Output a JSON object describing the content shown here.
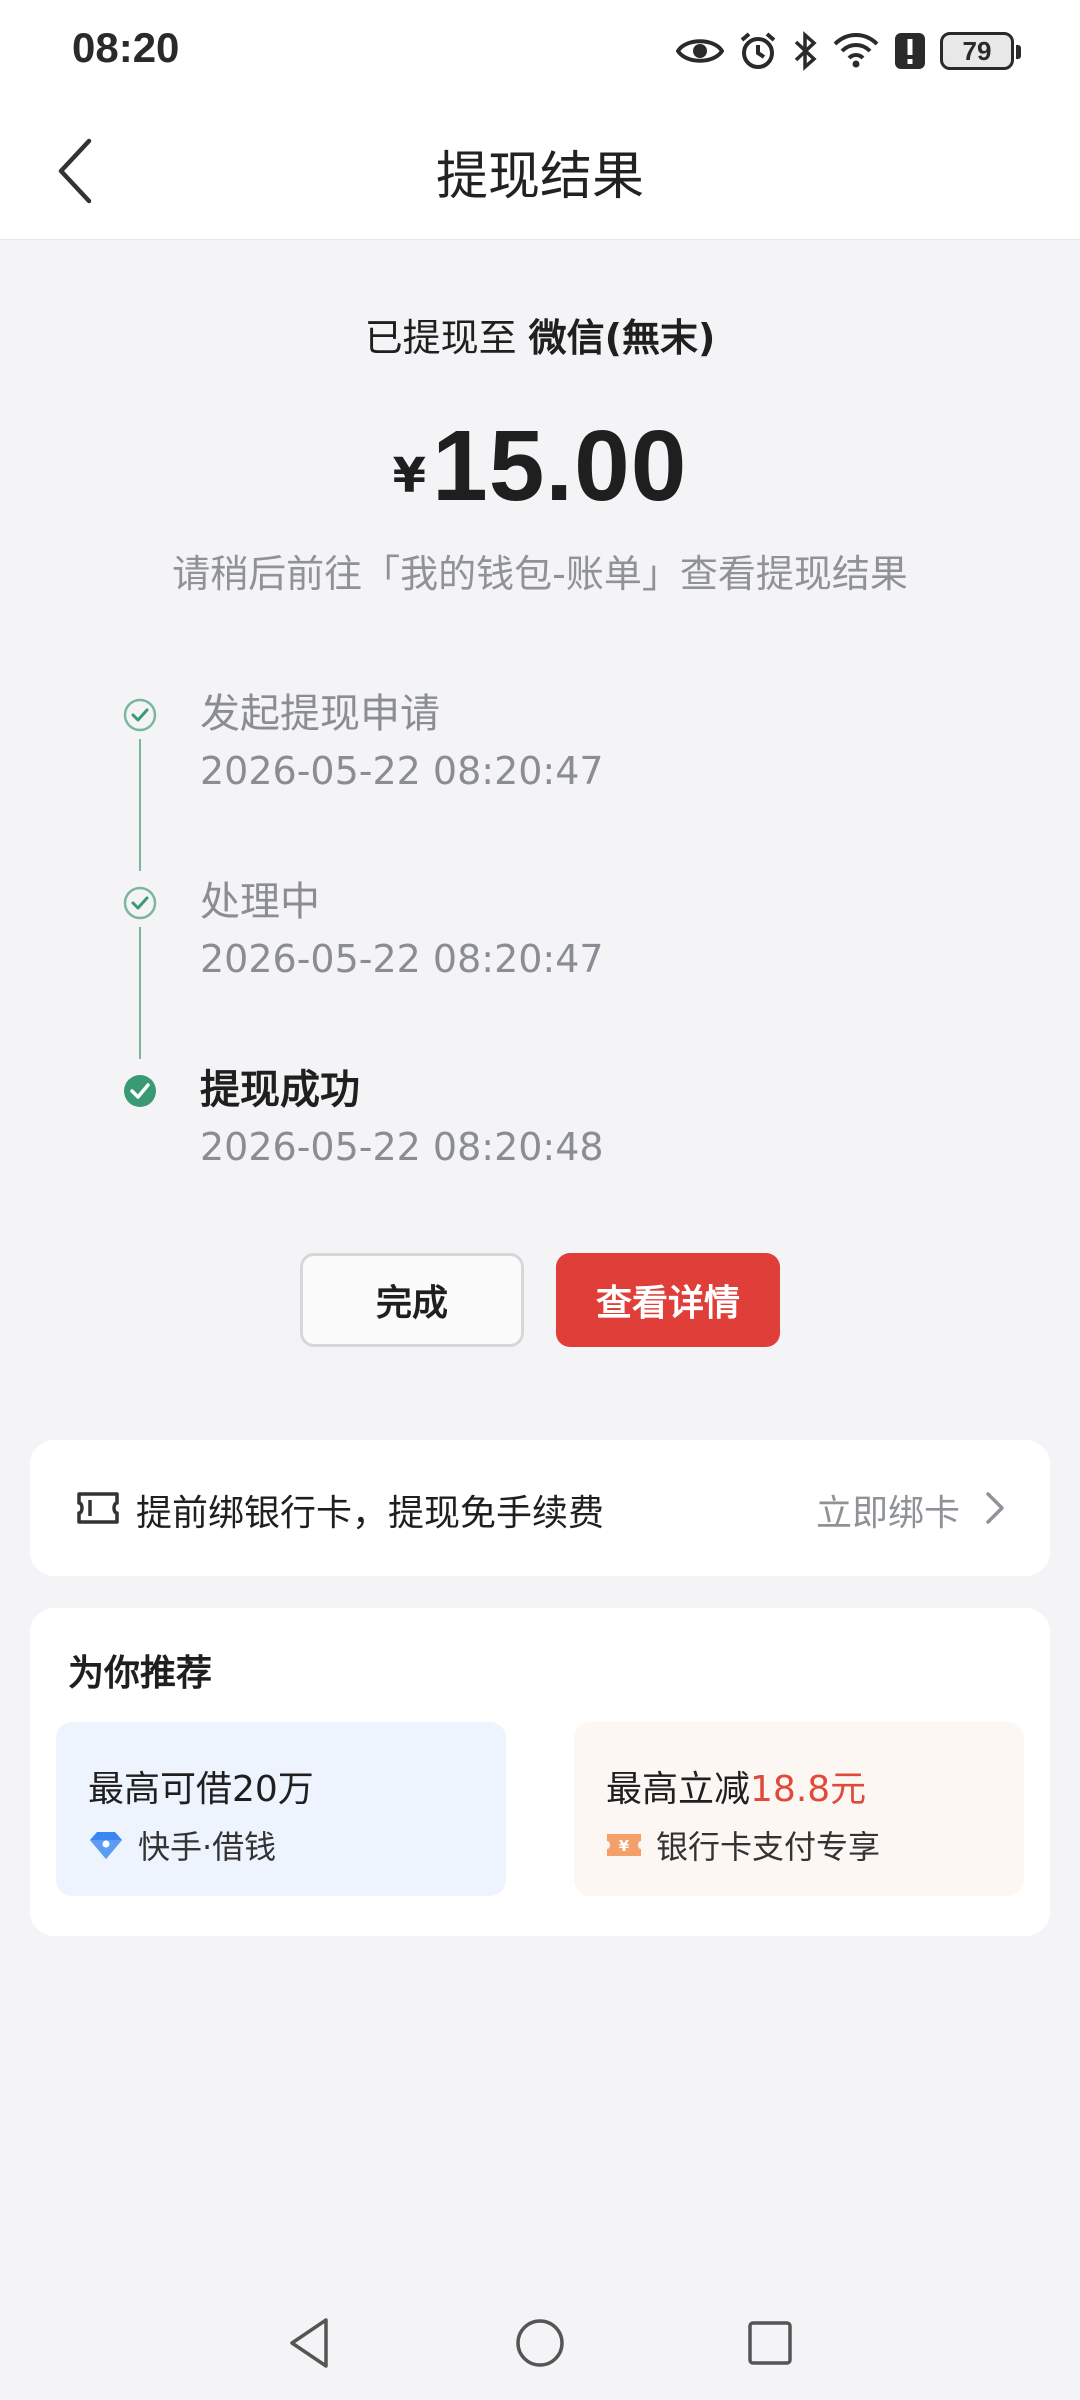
{
  "status_bar": {
    "time": "08:20",
    "battery": "79",
    "icons": [
      "eye-icon",
      "alarm-icon",
      "bluetooth-icon",
      "wifi-icon",
      "alert-icon",
      "battery-icon"
    ]
  },
  "header": {
    "title": "提现结果",
    "back_icon": "chevron-left-icon"
  },
  "result": {
    "dest_prefix": "已提现至 ",
    "dest_name": "微信(無末)",
    "currency": "¥",
    "amount": "15.00",
    "hint": "请稍后前往「我的钱包-账单」查看提现结果"
  },
  "timeline": [
    {
      "title": "发起提现申请",
      "time": "2026-05-22 08:20:47",
      "state": "passed"
    },
    {
      "title": "处理中",
      "time": "2026-05-22 08:20:47",
      "state": "passed"
    },
    {
      "title": "提现成功",
      "time": "2026-05-22 08:20:48",
      "state": "done"
    }
  ],
  "buttons": {
    "done_label": "完成",
    "detail_label": "查看详情"
  },
  "bind_card": {
    "text": "提前绑银行卡，提现免手续费",
    "action": "立即绑卡"
  },
  "recommend": {
    "title": "为你推荐",
    "items": [
      {
        "main": "最高可借20万",
        "highlight": "",
        "sub": "快手·借钱"
      },
      {
        "main": "最高立减",
        "highlight": "18.8元",
        "sub": "银行卡支付专享"
      }
    ]
  },
  "colors": {
    "accent_red": "#e03e39",
    "success_green": "#3a9a73",
    "highlight_red": "#e04a3a"
  }
}
